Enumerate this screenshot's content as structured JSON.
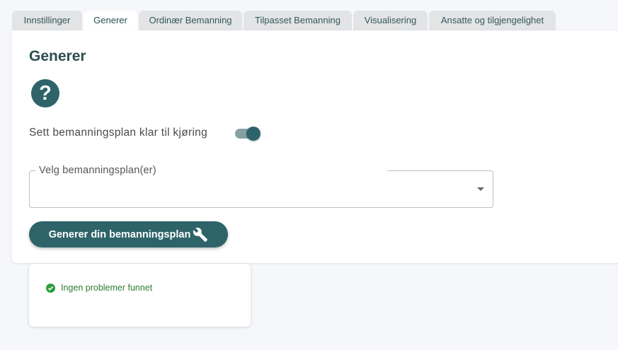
{
  "tabs": [
    {
      "label": "Innstillinger"
    },
    {
      "label": "Generer",
      "active": true
    },
    {
      "label": "Ordinær Bemanning"
    },
    {
      "label": "Tilpasset Bemanning"
    },
    {
      "label": "Visualisering"
    },
    {
      "label": "Ansatte og tilgjengelighet"
    }
  ],
  "panel": {
    "title": "Generer",
    "help_icon": "question-circle-icon",
    "help_glyph": "?",
    "toggle": {
      "label": "Sett bemanningsplan klar til kjøring",
      "checked": true
    },
    "select": {
      "label": "Velg bemanningsplan(er)",
      "value": ""
    },
    "generate_button": {
      "label": "Generer din bemanningsplan",
      "icon": "wrench-icon"
    }
  },
  "result": {
    "icon": "check-circle-icon",
    "message": "Ingen problemer funnet"
  },
  "colors": {
    "primary": "#2e6469",
    "title": "#2c4d52",
    "success": "#2e7d32",
    "tab_inactive_bg": "#e3e4e6",
    "page_bg": "#f6f7fa"
  }
}
